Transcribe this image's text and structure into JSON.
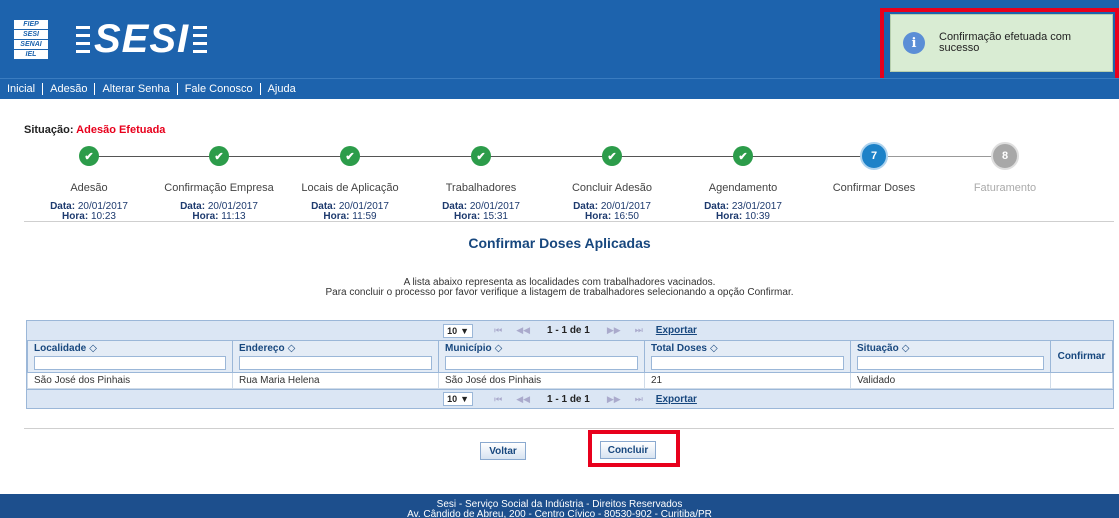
{
  "header": {
    "logo_lines": [
      "FIEP",
      "SESI",
      "SENAI",
      "IEL"
    ],
    "brand": "SESI"
  },
  "notification": {
    "text": "Confirmação efetuada com sucesso",
    "icon": "info-icon"
  },
  "nav": {
    "items": [
      "Inicial",
      "Adesão",
      "Alterar Senha",
      "Fale Conosco",
      "Ajuda"
    ]
  },
  "status": {
    "label": "Situação:",
    "value": "Adesão Efetuada"
  },
  "steps": [
    {
      "label": "Adesão",
      "state": "done",
      "date": "20/01/2017",
      "time": "10:23"
    },
    {
      "label": "Confirmação Empresa",
      "state": "done",
      "date": "20/01/2017",
      "time": "11:13"
    },
    {
      "label": "Locais de Aplicação",
      "state": "done",
      "date": "20/01/2017",
      "time": "11:59"
    },
    {
      "label": "Trabalhadores",
      "state": "done",
      "date": "20/01/2017",
      "time": "15:31"
    },
    {
      "label": "Concluir Adesão",
      "state": "done",
      "date": "20/01/2017",
      "time": "16:50"
    },
    {
      "label": "Agendamento",
      "state": "done",
      "date": "23/01/2017",
      "time": "10:39"
    },
    {
      "label": "Confirmar Doses",
      "state": "current",
      "number": "7"
    },
    {
      "label": "Faturamento",
      "state": "pending",
      "number": "8"
    }
  ],
  "step_text": {
    "date_label": "Data:",
    "time_label": "Hora:",
    "check": "✔"
  },
  "page": {
    "title": "Confirmar Doses Aplicadas",
    "desc_line1": "A lista abaixo representa as localidades com trabalhadores vacinados.",
    "desc_line2": "Para concluir o processo por favor verifique a listagem de trabalhadores selecionando a opção Confirmar."
  },
  "pager": {
    "page_size": "10",
    "range": "1 - 1 de 1",
    "export": "Exportar"
  },
  "table": {
    "columns": [
      "Localidade",
      "Endereço",
      "Município",
      "Total Doses",
      "Situação",
      "Confirmar"
    ],
    "rows": [
      [
        "São José dos Pinhais",
        "Rua Maria Helena",
        "São José dos Pinhais",
        "21",
        "Validado",
        ""
      ]
    ]
  },
  "buttons": {
    "back": "Voltar",
    "conclude": "Concluir"
  },
  "footer": {
    "line1": "Sesi - Serviço Social da Indústria - Direitos Reservados",
    "line2": "Av. Cândido de Abreu, 200 - Centro Cívico - 80530-902 - Curitiba/PR"
  },
  "colors": {
    "header_blue": "#1d63ad",
    "done_green": "#2c9c4a",
    "current_blue": "#1d82c8",
    "pending_gray": "#a8a8a8",
    "alert_red": "#e8001c",
    "notify_bg": "#d9ecd3"
  }
}
